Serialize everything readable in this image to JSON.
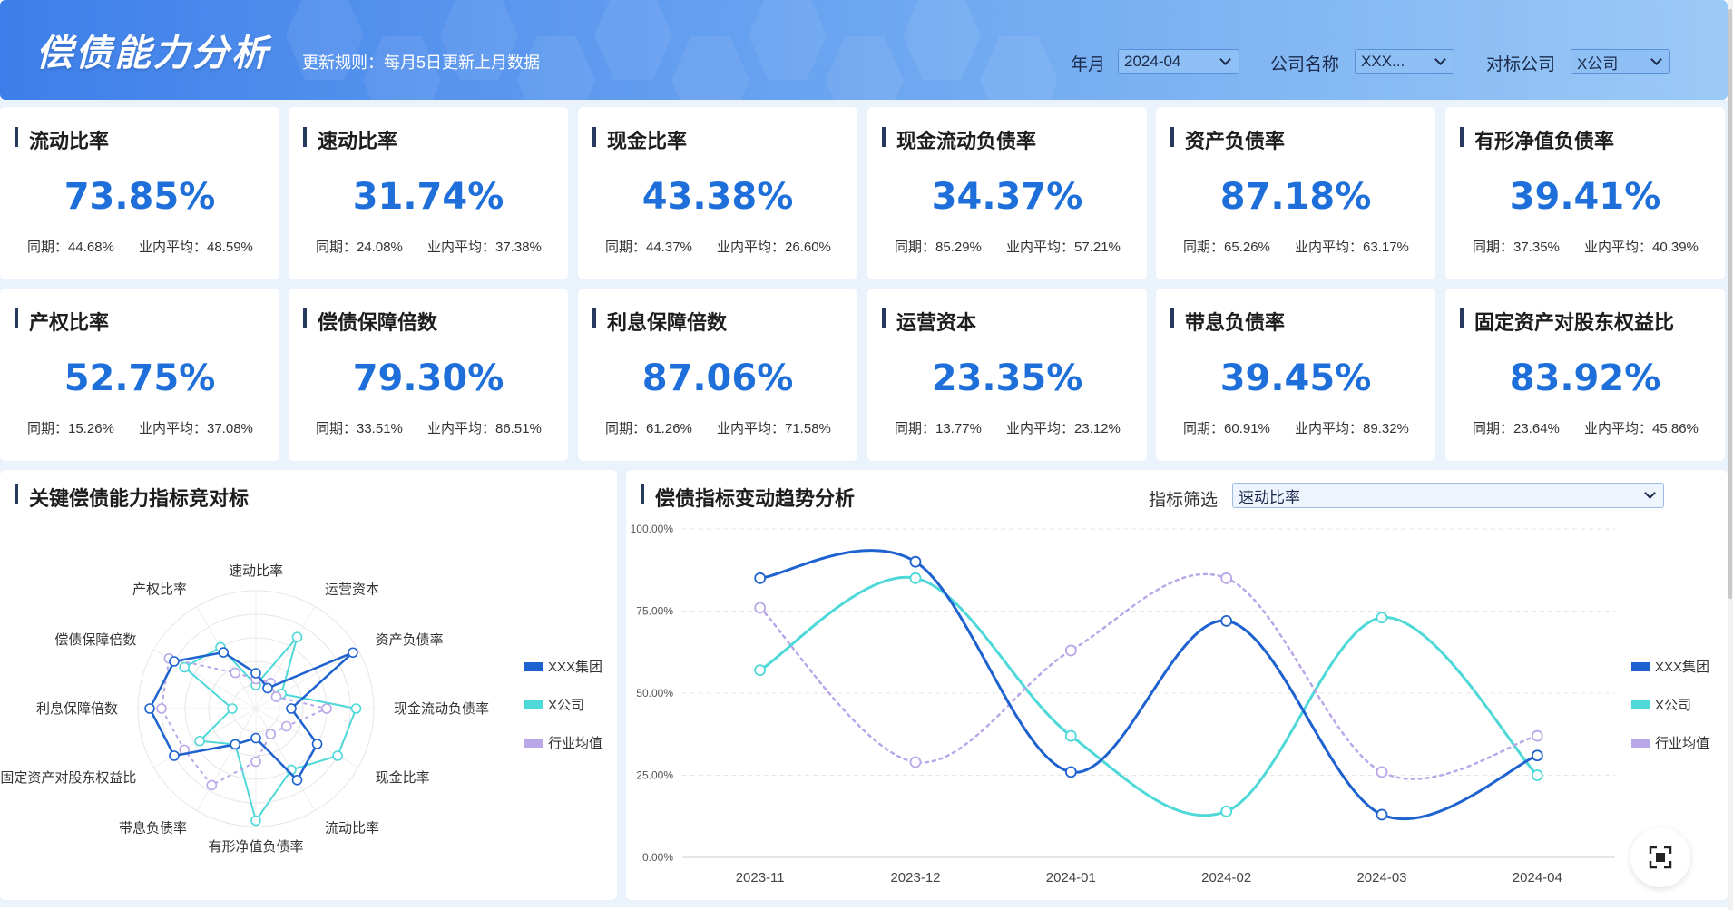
{
  "header": {
    "title": "偿债能力分析",
    "rule": "更新规则：每月5日更新上月数据",
    "filters": [
      {
        "label": "年月",
        "value": "2024-04"
      },
      {
        "label": "公司名称",
        "value": "XXX..."
      },
      {
        "label": "对标公司",
        "value": "X公司"
      }
    ]
  },
  "kpis": [
    {
      "title": "流动比率",
      "value": "73.85%",
      "same_period": "同期：44.68%",
      "industry": "业内平均：48.59%"
    },
    {
      "title": "速动比率",
      "value": "31.74%",
      "same_period": "同期：24.08%",
      "industry": "业内平均：37.38%"
    },
    {
      "title": "现金比率",
      "value": "43.38%",
      "same_period": "同期：44.37%",
      "industry": "业内平均：26.60%"
    },
    {
      "title": "现金流动负债率",
      "value": "34.37%",
      "same_period": "同期：85.29%",
      "industry": "业内平均：57.21%"
    },
    {
      "title": "资产负债率",
      "value": "87.18%",
      "same_period": "同期：65.26%",
      "industry": "业内平均：63.17%"
    },
    {
      "title": "有形净值负债率",
      "value": "39.41%",
      "same_period": "同期：37.35%",
      "industry": "业内平均：40.39%"
    },
    {
      "title": "产权比率",
      "value": "52.75%",
      "same_period": "同期：15.26%",
      "industry": "业内平均：37.08%"
    },
    {
      "title": "偿债保障倍数",
      "value": "79.30%",
      "same_period": "同期：33.51%",
      "industry": "业内平均：86.51%"
    },
    {
      "title": "利息保障倍数",
      "value": "87.06%",
      "same_period": "同期：61.26%",
      "industry": "业内平均：71.58%"
    },
    {
      "title": "运营资本",
      "value": "23.35%",
      "same_period": "同期：13.77%",
      "industry": "业内平均：23.12%"
    },
    {
      "title": "带息负债率",
      "value": "39.45%",
      "same_period": "同期：60.91%",
      "industry": "业内平均：89.32%"
    },
    {
      "title": "固定资产对股东权益比",
      "value": "83.92%",
      "same_period": "同期：23.64%",
      "industry": "业内平均：45.86%"
    }
  ],
  "radar_panel": {
    "title": "关键偿债能力指标竞对标"
  },
  "trend_panel": {
    "title": "偿债指标变动趋势分析",
    "filter_label": "指标筛选",
    "filter_value": "速动比率"
  },
  "chart_data": [
    {
      "type": "radar",
      "indicators": [
        "速动比率",
        "运营资本",
        "资产负债率",
        "现金流动负债率",
        "现金比率",
        "流动比率",
        "有形净值负债率",
        "带息负债率",
        "固定资产对股东权益比",
        "利息保障倍数",
        "偿债保障倍数",
        "产权比率"
      ],
      "max": 100,
      "series": [
        {
          "name": "XXX集团",
          "color": "#1e62d0",
          "values": [
            30,
            20,
            95,
            30,
            60,
            70,
            25,
            35,
            80,
            90,
            80,
            55
          ]
        },
        {
          "name": "X公司",
          "color": "#4fd8d8",
          "values": [
            20,
            70,
            25,
            85,
            80,
            60,
            95,
            35,
            55,
            20,
            70,
            60
          ]
        },
        {
          "name": "行业均值",
          "color": "#b9a7e8",
          "values": [
            25,
            25,
            20,
            60,
            30,
            25,
            45,
            75,
            70,
            80,
            85,
            35
          ]
        }
      ]
    },
    {
      "type": "line",
      "x": [
        "2023-11",
        "2023-12",
        "2024-01",
        "2024-02",
        "2024-03",
        "2024-04"
      ],
      "ylim": [
        0,
        100
      ],
      "yticks": [
        "0.00%",
        "25.00%",
        "50.00%",
        "75.00%",
        "100.00%"
      ],
      "series": [
        {
          "name": "XXX集团",
          "color": "#1e62d0",
          "values": [
            85,
            90,
            26,
            72,
            13,
            31
          ]
        },
        {
          "name": "X公司",
          "color": "#4fd8d8",
          "values": [
            57,
            85,
            37,
            14,
            73,
            25
          ]
        },
        {
          "name": "行业均值",
          "color": "#b9a7e8",
          "values": [
            76,
            29,
            63,
            85,
            26,
            37
          ]
        }
      ]
    }
  ]
}
